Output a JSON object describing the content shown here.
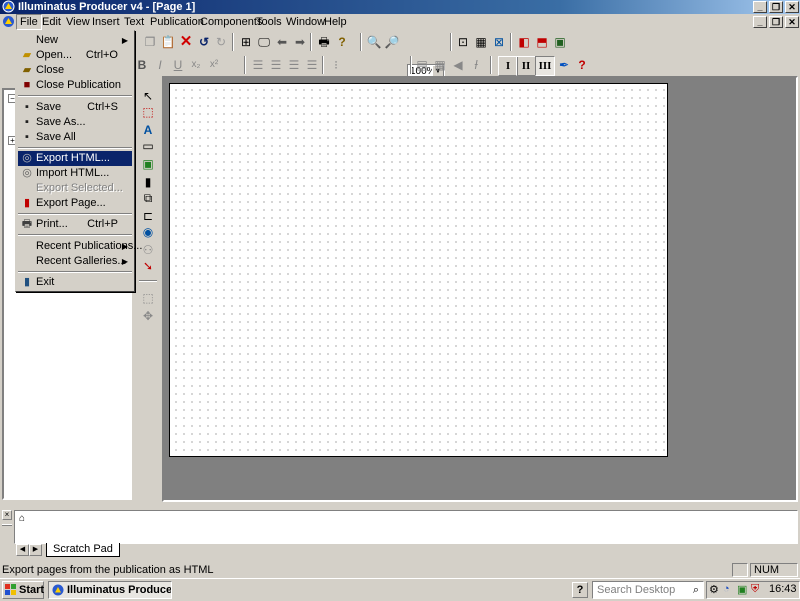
{
  "window": {
    "title": "Illuminatus Producer v4 - [Page 1]",
    "caption_buttons": [
      "_",
      "❐",
      "✕"
    ],
    "mdi_buttons": [
      "_",
      "❐",
      "✕"
    ]
  },
  "menubar": {
    "items": [
      "File",
      "Edit",
      "View",
      "Insert",
      "Text",
      "Publication",
      "Components",
      "Tools",
      "Window",
      "Help"
    ]
  },
  "toolbar": {
    "zoom_value": "100%"
  },
  "text_toolbar": {
    "font_size_value": "",
    "style_buttons": [
      "I",
      "II",
      "III"
    ]
  },
  "file_menu": {
    "items": [
      {
        "label": "New",
        "shortcut": "",
        "submenu": true,
        "icon": "",
        "disabled": false,
        "highlighted": false
      },
      {
        "label": "Open...",
        "shortcut": "Ctrl+O",
        "submenu": false,
        "icon": "open-folder-icon",
        "disabled": false,
        "highlighted": false
      },
      {
        "label": "Close",
        "shortcut": "",
        "submenu": false,
        "icon": "close-folder-icon",
        "disabled": false,
        "highlighted": false
      },
      {
        "label": "Close Publication",
        "shortcut": "",
        "submenu": false,
        "icon": "book-icon",
        "disabled": false,
        "highlighted": false
      },
      {
        "label": "Save",
        "shortcut": "Ctrl+S",
        "submenu": false,
        "icon": "floppy-icon",
        "disabled": false,
        "highlighted": false
      },
      {
        "label": "Save As...",
        "shortcut": "",
        "submenu": false,
        "icon": "floppy-as-icon",
        "disabled": false,
        "highlighted": false
      },
      {
        "label": "Save All",
        "shortcut": "",
        "submenu": false,
        "icon": "floppy-all-icon",
        "disabled": false,
        "highlighted": false
      },
      {
        "label": "Export HTML...",
        "shortcut": "",
        "submenu": false,
        "icon": "globe-export-icon",
        "disabled": false,
        "highlighted": true
      },
      {
        "label": "Import HTML...",
        "shortcut": "",
        "submenu": false,
        "icon": "globe-import-icon",
        "disabled": false,
        "highlighted": false
      },
      {
        "label": "Export Selected...",
        "shortcut": "",
        "submenu": false,
        "icon": "",
        "disabled": true,
        "highlighted": false
      },
      {
        "label": "Export Page...",
        "shortcut": "",
        "submenu": false,
        "icon": "page-export-icon",
        "disabled": false,
        "highlighted": false
      },
      {
        "label": "Print...",
        "shortcut": "Ctrl+P",
        "submenu": false,
        "icon": "printer-icon",
        "disabled": false,
        "highlighted": false
      },
      {
        "label": "Recent Publications...",
        "shortcut": "",
        "submenu": true,
        "icon": "",
        "disabled": false,
        "highlighted": false
      },
      {
        "label": "Recent Galleries...",
        "shortcut": "",
        "submenu": true,
        "icon": "",
        "disabled": false,
        "highlighted": false
      },
      {
        "label": "Exit",
        "shortcut": "",
        "submenu": false,
        "icon": "exit-door-icon",
        "disabled": false,
        "highlighted": false
      }
    ]
  },
  "scratch_pad": {
    "tab_label": "Scratch Pad"
  },
  "statusbar": {
    "message": "Export pages from the publication as HTML",
    "num_indicator": "NUM"
  },
  "taskbar": {
    "start_label": "Start",
    "app_label": "Illuminatus Producer ...",
    "search_placeholder": "Search Desktop",
    "clock": "16:43"
  },
  "colors": {
    "titlebar_start": "#0a246a",
    "titlebar_end": "#a6caf0",
    "menu_highlight": "#0a246a",
    "face": "#d4d0c8",
    "workspace": "#808080"
  }
}
